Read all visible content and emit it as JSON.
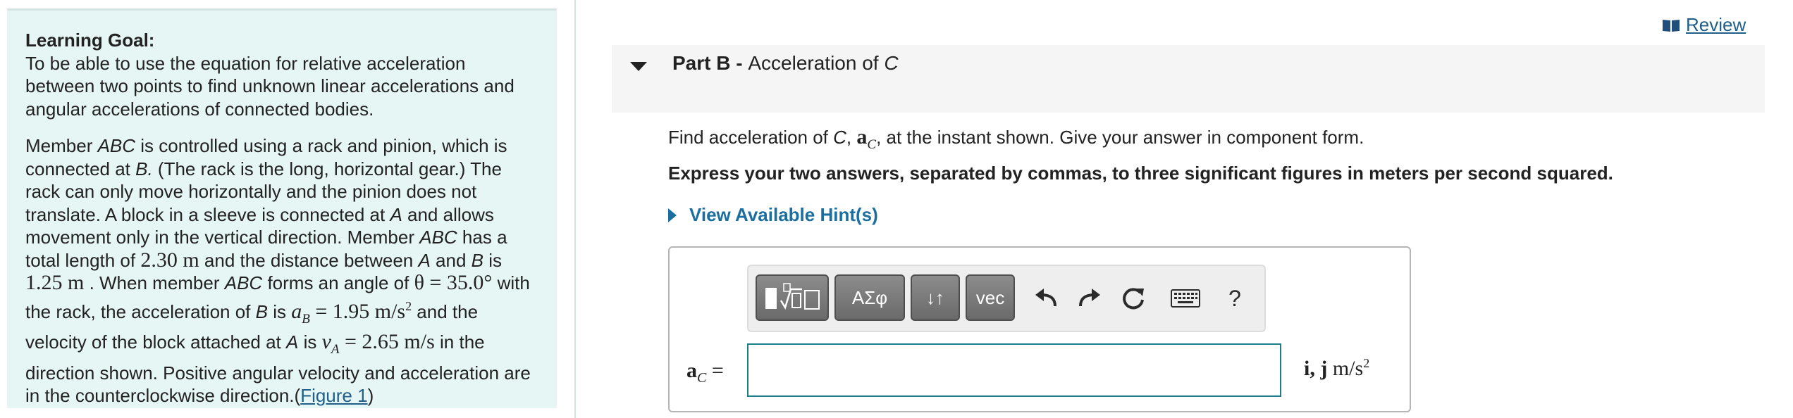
{
  "goal": {
    "title": "Learning Goal:",
    "text": "To be able to use the equation for relative acceleration between two points to find unknown linear accelerations and angular accelerations of connected bodies."
  },
  "problem": {
    "t1": "Member ",
    "member": "ABC",
    "t2": " is controlled using a rack and pinion, which is connected at ",
    "pointB": "B.",
    "t3": " (The rack is the long, horizontal gear.) The rack can only move horizontally and the pinion does not translate. A block in a sleeve is connected at ",
    "pointA": "A",
    "t4": " and allows movement only in the vertical direction. Member ",
    "member2": "ABC",
    "t5": " has a total length of ",
    "length": "2.30 m",
    "t6": " and the distance between ",
    "a1": "A",
    "t7": " and ",
    "b1": "B",
    "t8": " is ",
    "dist": "1.25 m",
    "t9": " . When member ",
    "member3": "ABC",
    "t10": " forms an angle of ",
    "theta": "θ = 35.0°",
    "t11": " with the rack, the acceleration of ",
    "b2": "B",
    "t12": " is ",
    "aB_sym": "a",
    "aB_sub": "B",
    "aB_val": " = 1.95 m/s",
    "aB_sup": "2",
    "t13": " and the velocity of the block attached at ",
    "a2": "A",
    "t14": " is ",
    "vA_sym": "v",
    "vA_sub": "A",
    "vA_val": " = 2.65 m/s",
    "t15": " in the direction shown. Positive angular velocity and acceleration are in the counterclockwise direction.(",
    "figure_link": "Figure 1",
    "t16": ")"
  },
  "review": {
    "label": "Review",
    "icon": "book-icon"
  },
  "part": {
    "label": "Part B - ",
    "title_text": "Acceleration of ",
    "title_var": "C"
  },
  "question": {
    "t1": "Find acceleration of ",
    "c": "C",
    "t2": ", ",
    "sym": "a",
    "sub": "C",
    "t3": ", at the instant shown. Give your answer in component form."
  },
  "instruction": "Express your two answers, separated by commas, to three significant figures in meters per second squared.",
  "hints_label": "View Available Hint(s)",
  "toolbar": {
    "greek_label": "ΑΣφ",
    "arrows_label": "↓↑",
    "vec_label": "vec",
    "help_label": "?",
    "icons": [
      "templates-icon",
      "undo-icon",
      "redo-icon",
      "reset-icon",
      "keyboard-icon",
      "help-icon"
    ]
  },
  "answer": {
    "label_sym": "a",
    "label_sub": "C",
    "label_eq": " =",
    "value": "",
    "units_ij": "i, j",
    "units_m": " m/s",
    "units_sup": "2"
  }
}
